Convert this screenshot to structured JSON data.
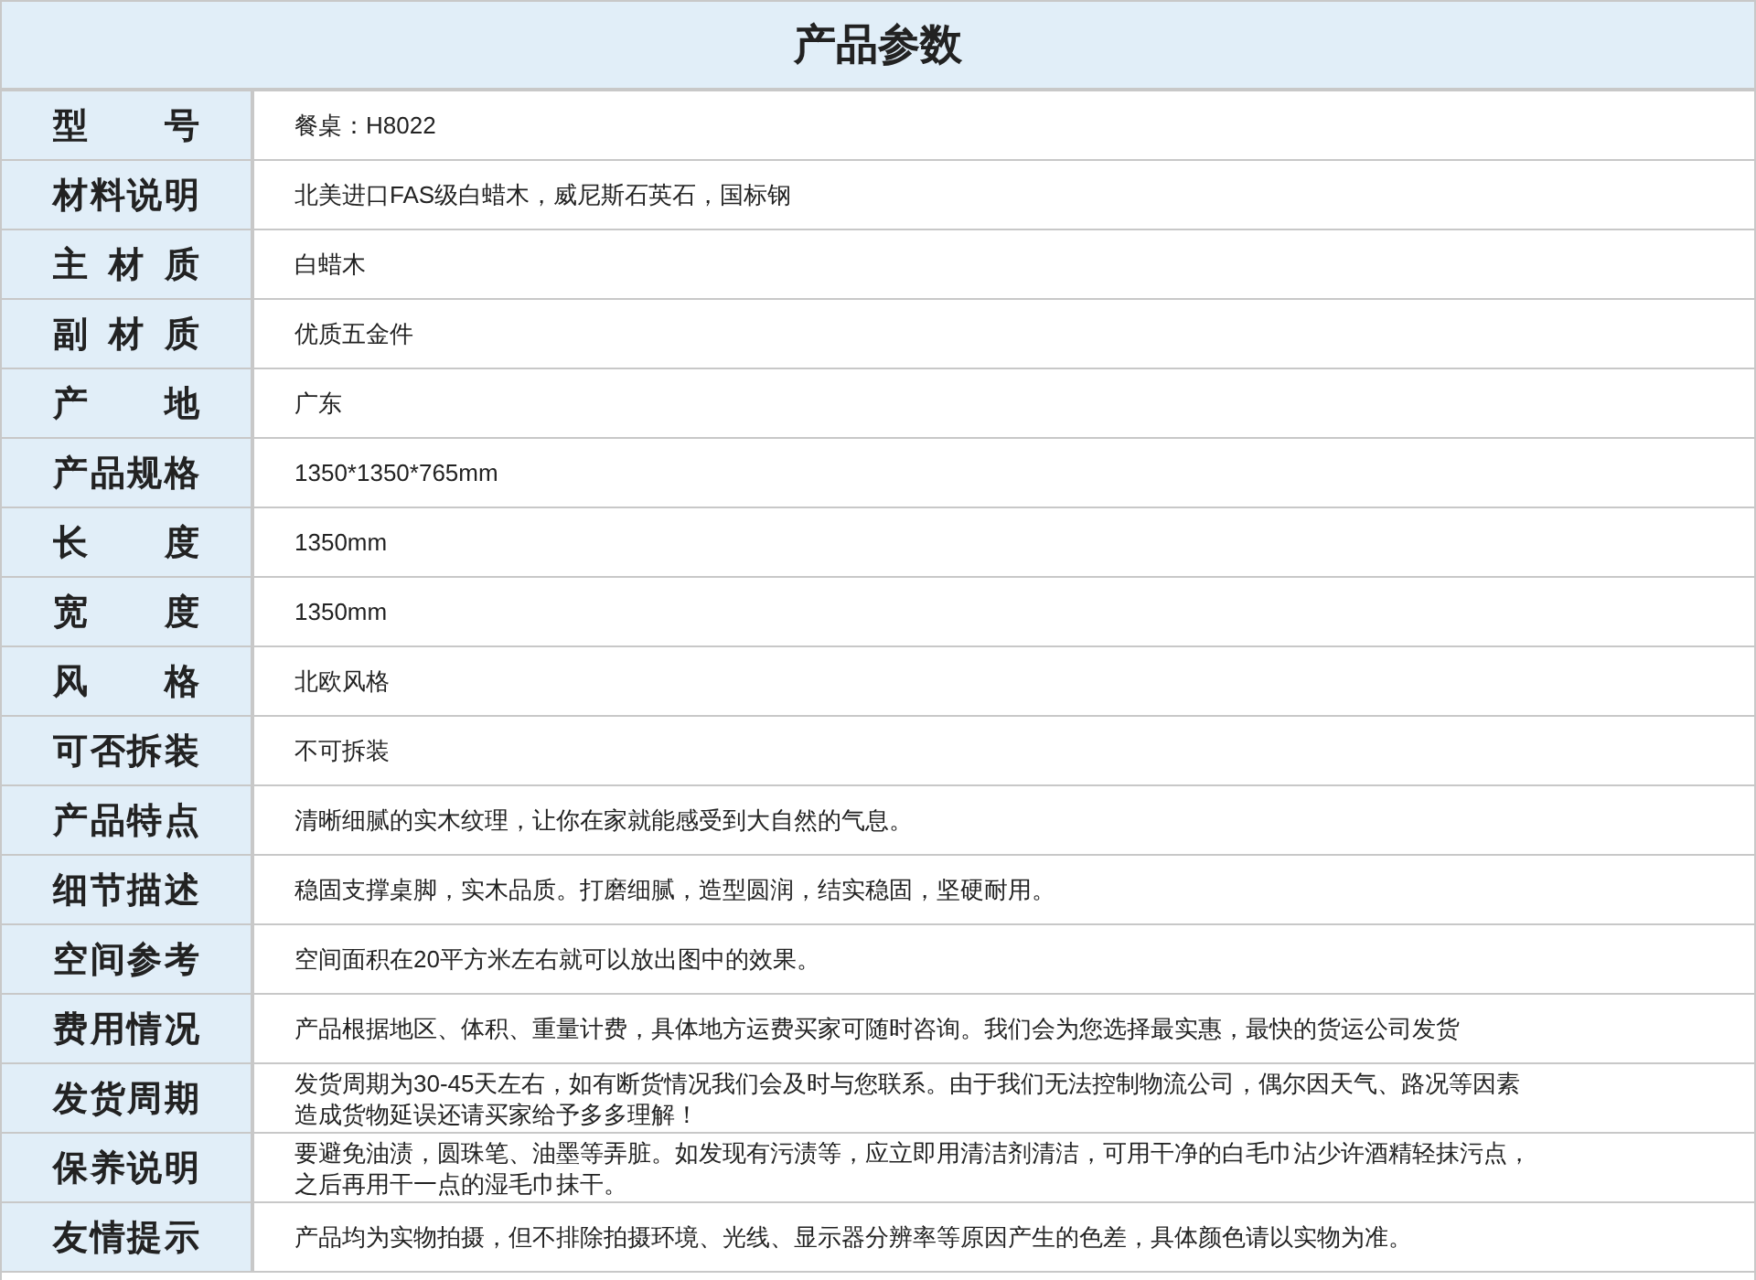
{
  "title": "产品参数",
  "rows": [
    {
      "label": "型号",
      "lines": [
        "餐桌：H8022"
      ]
    },
    {
      "label": "材料说明",
      "lines": [
        "北美进口FAS级白蜡木，威尼斯石英石，国标钢"
      ]
    },
    {
      "label": "主材质",
      "lines": [
        "白蜡木"
      ]
    },
    {
      "label": "副材质",
      "lines": [
        "优质五金件"
      ]
    },
    {
      "label": "产地",
      "lines": [
        "广东"
      ]
    },
    {
      "label": "产品规格",
      "lines": [
        "1350*1350*765mm"
      ]
    },
    {
      "label": "长度",
      "lines": [
        "1350mm"
      ]
    },
    {
      "label": "宽度",
      "lines": [
        "1350mm"
      ]
    },
    {
      "label": "风格",
      "lines": [
        "北欧风格"
      ]
    },
    {
      "label": "可否拆装",
      "lines": [
        "不可拆装"
      ]
    },
    {
      "label": "产品特点",
      "lines": [
        "清晰细腻的实木纹理，让你在家就能感受到大自然的气息。"
      ]
    },
    {
      "label": "细节描述",
      "lines": [
        "稳固支撑桌脚，实木品质。打磨细腻，造型圆润，结实稳固，坚硬耐用。"
      ]
    },
    {
      "label": "空间参考",
      "lines": [
        "空间面积在20平方米左右就可以放出图中的效果。"
      ]
    },
    {
      "label": "费用情况",
      "lines": [
        "产品根据地区、体积、重量计费，具体地方运费买家可随时咨询。我们会为您选择最实惠，最快的货运公司发货"
      ]
    },
    {
      "label": "发货周期",
      "lines": [
        "发货周期为30-45天左右，如有断货情况我们会及时与您联系。由于我们无法控制物流公司，偶尔因天气、路况等因素",
        "造成货物延误还请买家给予多多理解！"
      ]
    },
    {
      "label": "保养说明",
      "lines": [
        "要避免油渍，圆珠笔、油墨等弄脏。如发现有污渍等，应立即用清洁剂清洁，可用干净的白毛巾沾少许酒精轻抹污点，",
        "之后再用干一点的湿毛巾抹干。"
      ]
    },
    {
      "label": "友情提示",
      "lines": [
        "产品均为实物拍摄，但不排除拍摄环境、光线、显示器分辨率等原因产生的色差，具体颜色请以实物为准。"
      ]
    }
  ]
}
